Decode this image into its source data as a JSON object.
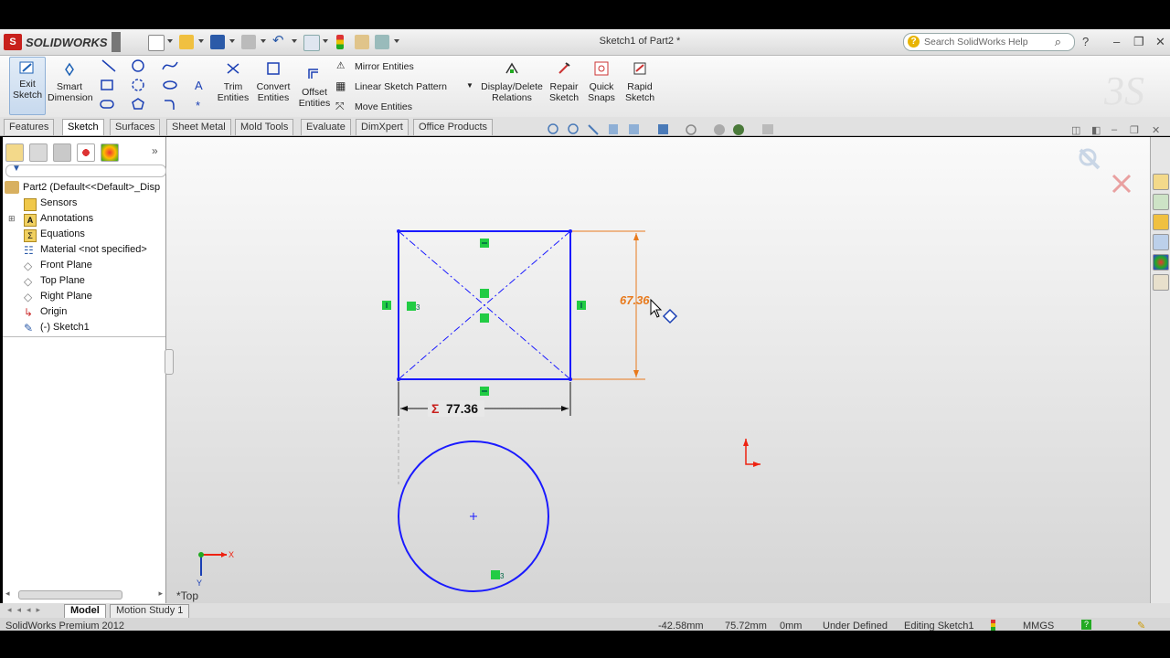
{
  "app": {
    "brand": "SOLIDWORKS",
    "doc_title": "Sketch1 of Part2 *",
    "search_placeholder": "Search SolidWorks Help"
  },
  "command_manager": {
    "exit_sketch": "Exit Sketch",
    "smart_dimension": "Smart Dimension",
    "trim_entities": "Trim Entities",
    "convert_entities": "Convert Entities",
    "offset_entities": "Offset Entities",
    "mirror_entities": "Mirror Entities",
    "linear_sketch_pattern": "Linear Sketch Pattern",
    "move_entities": "Move Entities",
    "display_delete_relations": "Display/Delete Relations",
    "repair_sketch": "Repair Sketch",
    "quick_snaps": "Quick Snaps",
    "rapid_sketch": "Rapid Sketch"
  },
  "tabs": [
    "Features",
    "Sketch",
    "Surfaces",
    "Sheet Metal",
    "Mold Tools",
    "Evaluate",
    "DimXpert",
    "Office Products"
  ],
  "active_tab": "Sketch",
  "feature_tree": {
    "root": "Part2  (Default<<Default>_Disp",
    "items": [
      "Sensors",
      "Annotations",
      "Equations",
      "Material <not specified>",
      "Front Plane",
      "Top Plane",
      "Right Plane",
      "Origin",
      "(-) Sketch1"
    ]
  },
  "graphics": {
    "dim_horizontal": "77.36",
    "dim_vertical": "67.36",
    "dim_sigma": "Σ",
    "view_label": "*Top",
    "axis_x": "X",
    "axis_y": "Y"
  },
  "bottom_tabs": [
    "Model",
    "Motion Study 1"
  ],
  "active_bottom_tab": "Model",
  "status": {
    "product": "SolidWorks Premium 2012",
    "x": "-42.58mm",
    "y": "75.72mm",
    "z": "0mm",
    "state": "Under Defined",
    "mode": "Editing Sketch1",
    "units": "MMGS"
  },
  "colors": {
    "sketch_blue": "#1a1aff",
    "dim_orange": "#e87a1d",
    "relation_green": "#22cc44",
    "brand_red": "#c8201c"
  }
}
